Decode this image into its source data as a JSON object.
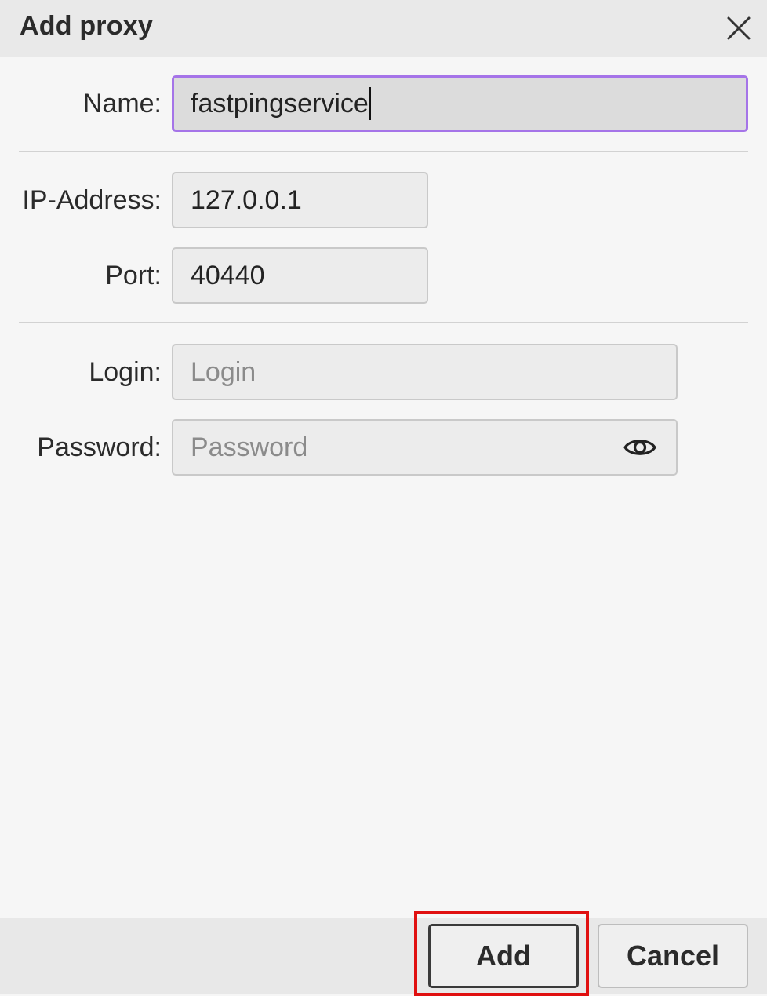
{
  "dialog": {
    "title": "Add proxy",
    "close_icon": "close-icon"
  },
  "form": {
    "name": {
      "label": "Name:",
      "value": "fastpingservice"
    },
    "ip": {
      "label": "IP-Address:",
      "value": "127.0.0.1"
    },
    "port": {
      "label": "Port:",
      "value": "40440"
    },
    "login": {
      "label": "Login:",
      "value": "",
      "placeholder": "Login"
    },
    "password": {
      "label": "Password:",
      "value": "",
      "placeholder": "Password",
      "toggle_icon": "eye-icon"
    }
  },
  "footer": {
    "add_label": "Add",
    "cancel_label": "Cancel"
  },
  "colors": {
    "focus_border": "#a574e8",
    "highlight": "#e01010"
  }
}
